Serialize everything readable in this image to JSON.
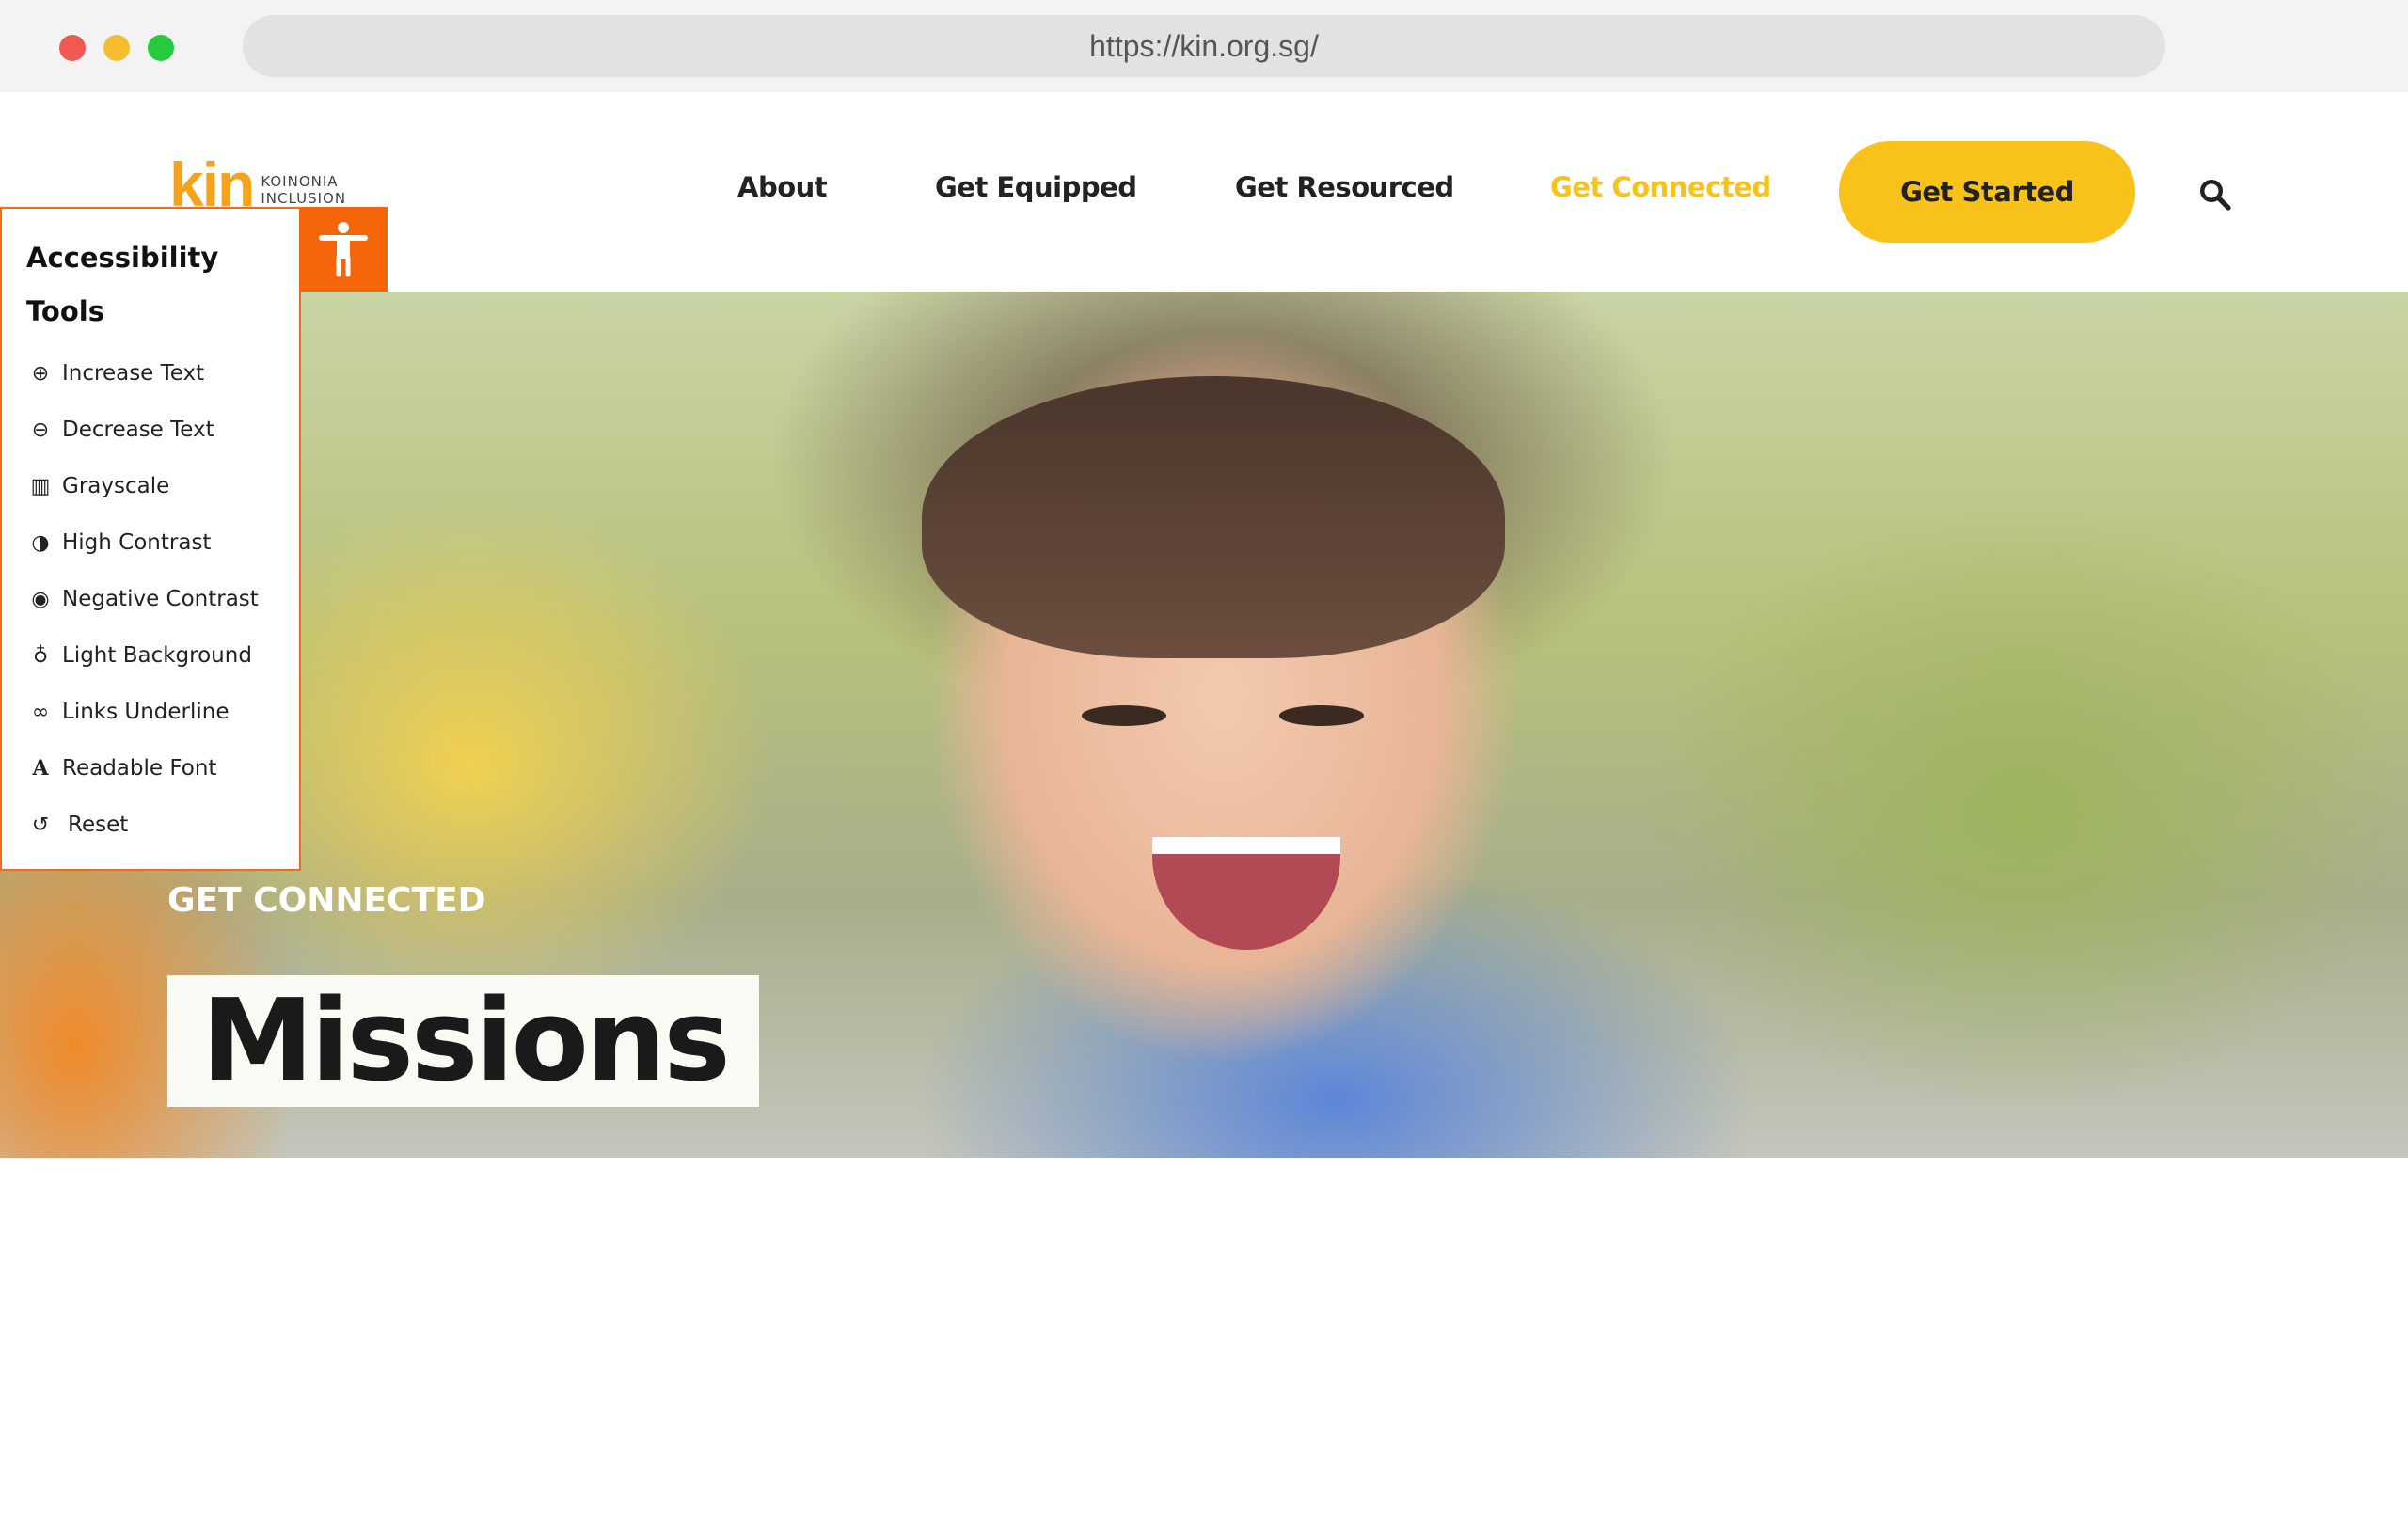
{
  "browser": {
    "url": "https://kin.org.sg/",
    "dots": [
      "#ee5a52",
      "#f5bd2f",
      "#27c93f"
    ]
  },
  "logo": {
    "brand": "kin",
    "line1": "KOINONIA",
    "line2": "INCLUSION"
  },
  "nav": {
    "items": [
      {
        "label": "About"
      },
      {
        "label": "Get Equipped"
      },
      {
        "label": "Get Resourced"
      },
      {
        "label": "Get Connected",
        "active": true
      }
    ],
    "cta": "Get Started",
    "active_color": "#f8c21a"
  },
  "accessibility": {
    "title": "Accessibility Tools",
    "items": [
      {
        "label": "Increase Text",
        "icon": "zoom-in-icon"
      },
      {
        "label": "Decrease Text",
        "icon": "zoom-out-icon"
      },
      {
        "label": "Grayscale",
        "icon": "barcode-icon"
      },
      {
        "label": "High Contrast",
        "icon": "contrast-icon"
      },
      {
        "label": "Negative Contrast",
        "icon": "eye-icon"
      },
      {
        "label": "Light Background",
        "icon": "lightbulb-icon"
      },
      {
        "label": "Links Underline",
        "icon": "link-icon"
      },
      {
        "label": "Readable Font",
        "icon": "font-icon"
      },
      {
        "label": "Reset",
        "icon": "reset-icon"
      }
    ],
    "accent": "#f5650a"
  },
  "hero": {
    "kicker": "GET CONNECTED",
    "title": "Missions"
  }
}
